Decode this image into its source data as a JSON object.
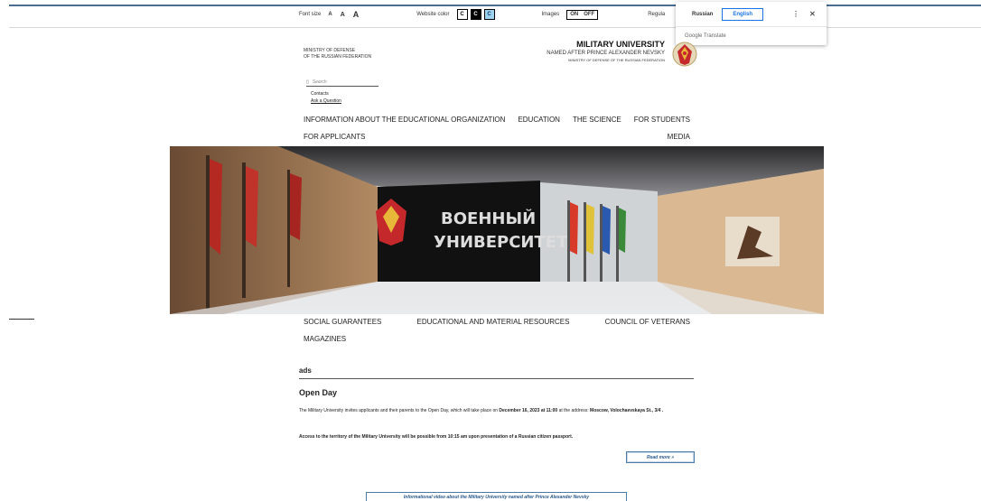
{
  "accessibility": {
    "font_size_label": "Font size",
    "font_size_options": [
      "A",
      "A",
      "A"
    ],
    "website_color_label": "Website color",
    "color_options": [
      "C",
      "C",
      "C"
    ],
    "images_label": "Images",
    "images_on": "ON",
    "images_off": "OFF",
    "regular_label": "Regula"
  },
  "translate": {
    "lang_russian": "Russian",
    "lang_english": "English",
    "more_icon": "⋮",
    "close_icon": "✕",
    "footer": "Google Translate"
  },
  "header": {
    "ministry_line1": "MINISTRY OF DEFENSE",
    "ministry_line2": "OF THE RUSSIAN FEDERATION",
    "university_title": "MILITARY UNIVERSITY",
    "university_sub": "NAMED AFTER PRINCE ALEXANDER NEVSKY",
    "university_ministry": "MINISTRY OF DEFENSE OF THE RUSSIAN FEDERATION"
  },
  "search": {
    "placeholder": "Search"
  },
  "links": {
    "contacts": "Contacts",
    "ask": "Ask a Question"
  },
  "nav_main": [
    "INFORMATION ABOUT THE EDUCATIONAL ORGANIZATION",
    "EDUCATION",
    "THE SCIENCE",
    "FOR STUDENTS"
  ],
  "nav_second": {
    "applicants": "FOR APPLICANTS",
    "media": "MEDIA"
  },
  "nav_bottom": [
    "SOCIAL GUARANTEES",
    "EDUCATIONAL AND MATERIAL RESOURCES",
    "COUNCIL OF VETERANS"
  ],
  "nav_magazines": "MAGAZINES",
  "hero": {
    "sign_line1": "ВОЕННЫЙ",
    "sign_line2": "УНИВЕРСИТЕТ"
  },
  "ads": {
    "heading": "ads",
    "title": "Open Day",
    "p1_a": "The Military University invites applicants and their parents to the Open Day, which will take place on ",
    "p1_date": "December 16, 2023 at 11:00",
    "p1_b": " at the address: ",
    "p1_addr": "Moscow, Volochaevskaya St., 3/4 .",
    "p2": "Access to the territory of the Military University will be possible from 10:15 am upon presentation of a Russian citizen passport.",
    "read_more": "Read more »"
  },
  "video_button": "Informational video about the Military University named after Prince Alexander Nevsky",
  "colors": {
    "accent": "#4a6e93",
    "link_blue": "#1a73e8"
  }
}
